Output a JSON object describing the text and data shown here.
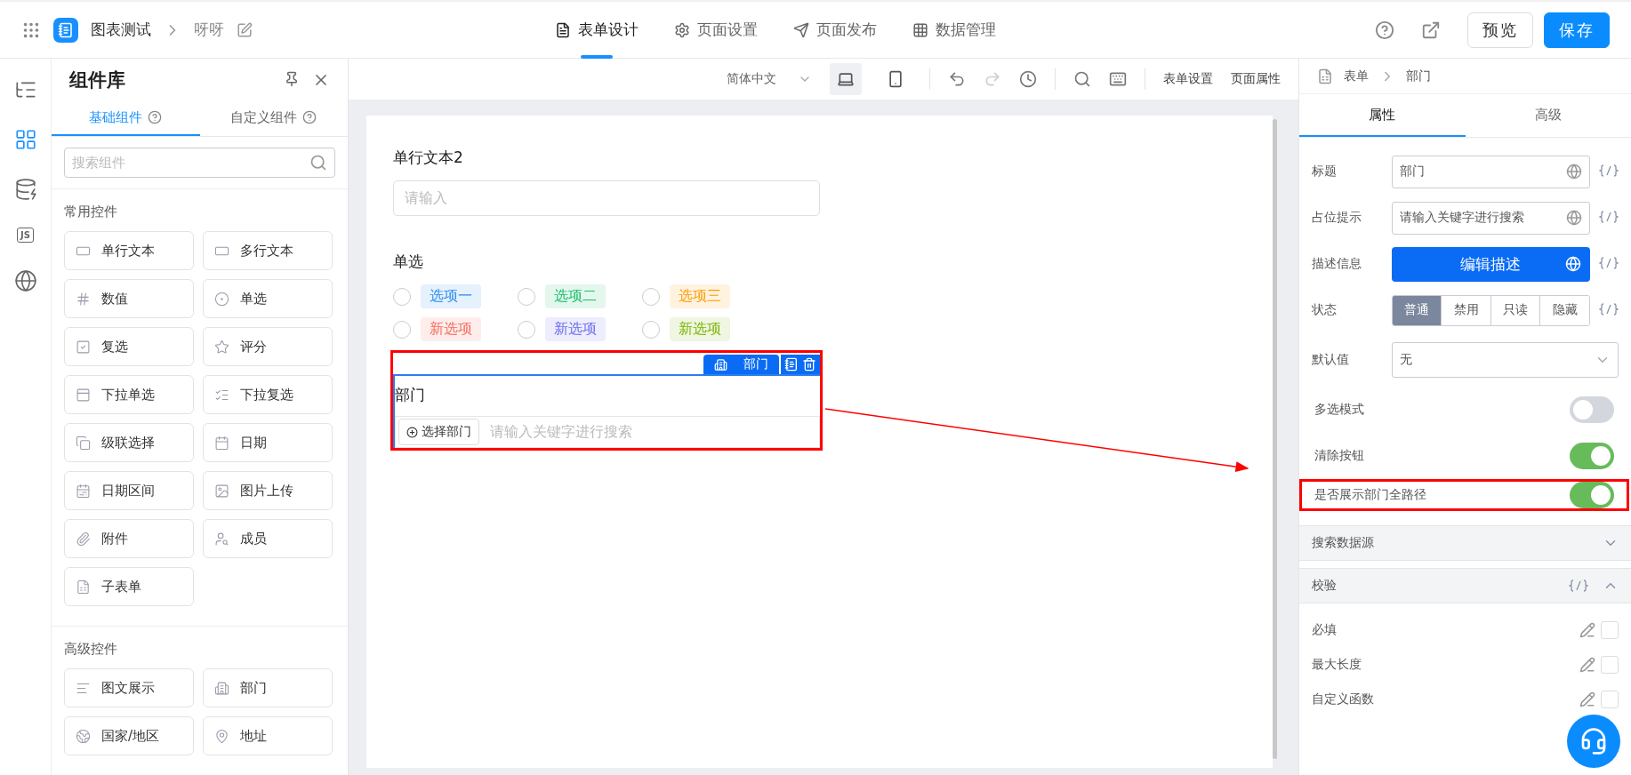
{
  "header": {
    "app_name": "图表测试",
    "page_name": "呀呀",
    "nav": [
      {
        "label": "表单设计",
        "selected": true
      },
      {
        "label": "页面设置",
        "selected": false
      },
      {
        "label": "页面发布",
        "selected": false
      },
      {
        "label": "数据管理",
        "selected": false
      }
    ],
    "buttons": [
      {
        "label": "预览",
        "kind": "secondary"
      },
      {
        "label": "保存",
        "kind": "primary"
      }
    ]
  },
  "rail": [
    {
      "kind": "outline",
      "selected": false
    },
    {
      "kind": "components",
      "selected": true
    },
    {
      "kind": "data",
      "selected": false
    },
    {
      "kind": "code",
      "label": "JS",
      "selected": false
    },
    {
      "kind": "globe",
      "selected": false
    }
  ],
  "library": {
    "title": "组件库",
    "tabs": [
      {
        "label": "基础组件",
        "selected": true
      },
      {
        "label": "自定义组件",
        "selected": false
      }
    ],
    "search": {
      "placeholder": "搜索组件"
    },
    "groups": [
      {
        "title": "常用控件",
        "items": [
          "单行文本",
          "多行文本",
          "数值",
          "单选",
          "复选",
          "评分",
          "下拉单选",
          "下拉复选",
          "级联选择",
          "日期",
          "日期区间",
          "图片上传",
          "附件",
          "成员",
          "子表单"
        ]
      },
      {
        "title": "高级控件",
        "items": [
          "图文展示",
          "部门",
          "国家/地区",
          "地址"
        ]
      }
    ]
  },
  "toolbar": {
    "language": "简体中文",
    "devices": [
      {
        "kind": "desktop",
        "selected": true
      },
      {
        "kind": "mobile",
        "selected": false
      }
    ],
    "links": [
      "表单设置",
      "页面属性"
    ]
  },
  "canvas": {
    "fields": [
      {
        "kind": "text",
        "label": "单行文本2",
        "placeholder": "请输入"
      },
      {
        "kind": "radio",
        "label": "单选",
        "options": [
          {
            "label": "选项一",
            "color": "#2d8cf0",
            "selected": false
          },
          {
            "label": "选项二",
            "color": "#19be6b",
            "selected": false
          },
          {
            "label": "选项三",
            "color": "#ff9900",
            "selected": false
          },
          {
            "label": "新选项",
            "color": "#f56c5c",
            "selected": false
          },
          {
            "label": "新选项",
            "color": "#6c6cf0",
            "selected": false
          },
          {
            "label": "新选项",
            "color": "#7cb305",
            "selected": false
          }
        ]
      },
      {
        "kind": "department",
        "label": "部门",
        "selected": true,
        "annotated": true,
        "tag": "部门",
        "button": "选择部门",
        "placeholder": "请输入关键字进行搜索"
      }
    ]
  },
  "properties": {
    "breadcrumb": [
      "表单",
      "部门"
    ],
    "tabs": [
      {
        "label": "属性",
        "selected": true
      },
      {
        "label": "高级",
        "selected": false
      }
    ],
    "rows": [
      {
        "kind": "input",
        "label": "标题",
        "value": "部门"
      },
      {
        "kind": "input",
        "label": "占位提示",
        "value": "请输入关键字进行搜索"
      },
      {
        "kind": "button",
        "label": "描述信息",
        "button": "编辑描述"
      },
      {
        "kind": "segments",
        "label": "状态",
        "options": [
          {
            "label": "普通",
            "selected": true
          },
          {
            "label": "禁用",
            "selected": false
          },
          {
            "label": "只读",
            "selected": false
          },
          {
            "label": "隐藏",
            "selected": false
          }
        ]
      },
      {
        "kind": "select",
        "label": "默认值",
        "value": "无"
      },
      {
        "kind": "switch",
        "label": "多选模式",
        "on": false,
        "annotated": false
      },
      {
        "kind": "switch",
        "label": "清除按钮",
        "on": true,
        "annotated": false
      },
      {
        "kind": "switch",
        "label": "是否展示部门全路径",
        "on": true,
        "annotated": true
      }
    ],
    "sections": [
      {
        "title": "搜索数据源",
        "expanded": false
      },
      {
        "title": "校验",
        "expanded": true,
        "code": true,
        "rules": [
          {
            "label": "必填",
            "checked": false
          },
          {
            "label": "最大长度",
            "checked": false
          },
          {
            "label": "自定义函数",
            "checked": false
          }
        ]
      }
    ]
  }
}
